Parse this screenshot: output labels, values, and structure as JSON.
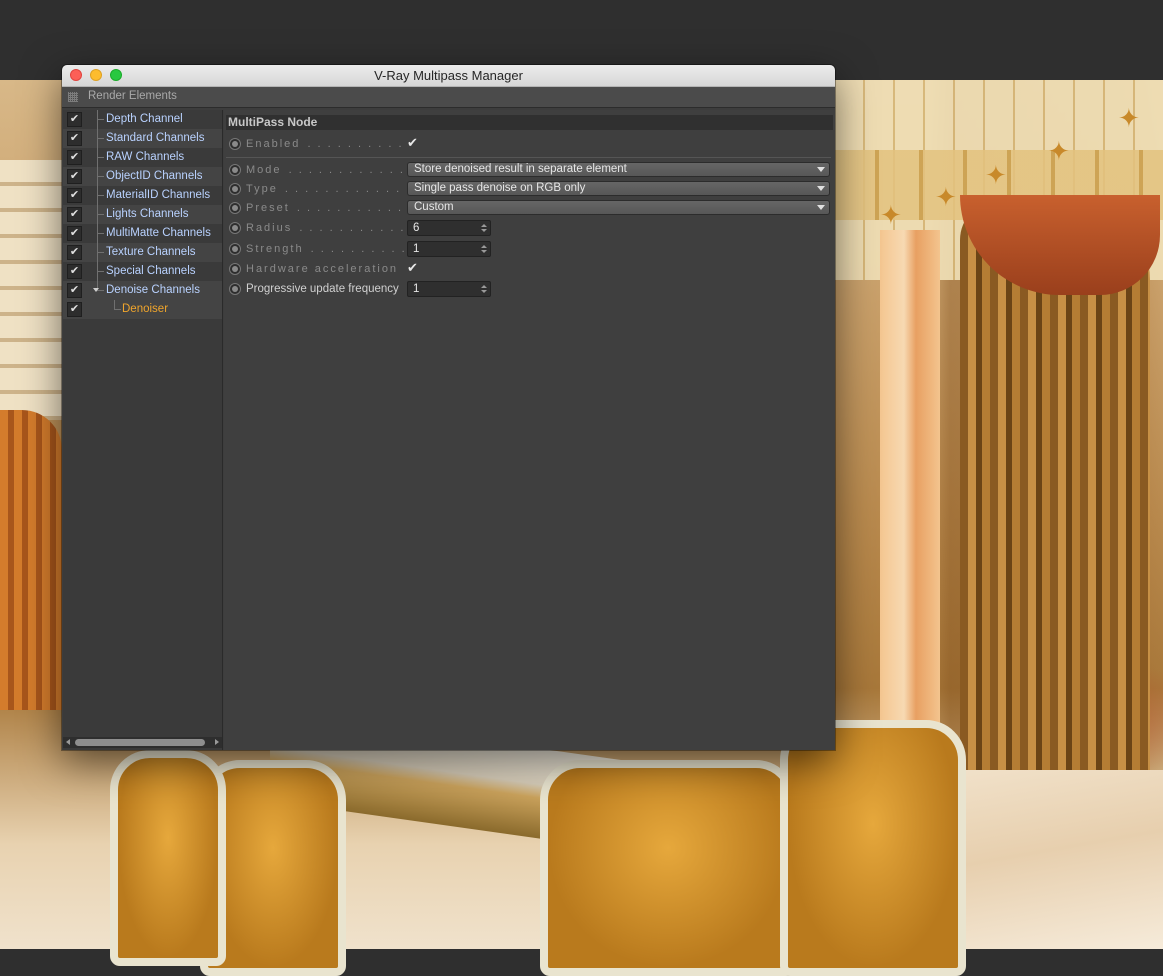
{
  "window": {
    "title": "V-Ray Multipass Manager",
    "menu_label": "Render Elements"
  },
  "tree": {
    "items": [
      {
        "label": "Depth Channel",
        "checked": true
      },
      {
        "label": "Standard Channels",
        "checked": true
      },
      {
        "label": "RAW Channels",
        "checked": true
      },
      {
        "label": "ObjectID Channels",
        "checked": true
      },
      {
        "label": "MaterialID Channels",
        "checked": true
      },
      {
        "label": "Lights Channels",
        "checked": true
      },
      {
        "label": "MultiMatte Channels",
        "checked": true
      },
      {
        "label": "Texture Channels",
        "checked": true
      },
      {
        "label": "Special Channels",
        "checked": true
      },
      {
        "label": "Denoise Channels",
        "checked": true,
        "expanded": true
      },
      {
        "label": "Denoiser",
        "checked": true,
        "selected": true
      }
    ],
    "check_glyph": "✔"
  },
  "panel": {
    "section_title": "MultiPass Node",
    "enabled_label": "Enabled",
    "enabled_value": true,
    "mode_label": "Mode",
    "mode_value": "Store denoised result in separate element",
    "type_label": "Type",
    "type_value": "Single pass denoise on RGB only",
    "preset_label": "Preset",
    "preset_value": "Custom",
    "radius_label": "Radius",
    "radius_value": "6",
    "strength_label": "Strength",
    "strength_value": "1",
    "hwaccel_label": "Hardware acceleration",
    "hwaccel_value": true,
    "progressive_label": "Progressive update frequency",
    "progressive_value": "1",
    "dots": ". . . . . . . . . . . . . . . . . . . . . . . . . . ."
  },
  "colors": {
    "tree_label": "#b9d2ff",
    "selected_label": "#f0a52c",
    "panel_bg": "#3f3f3f"
  }
}
